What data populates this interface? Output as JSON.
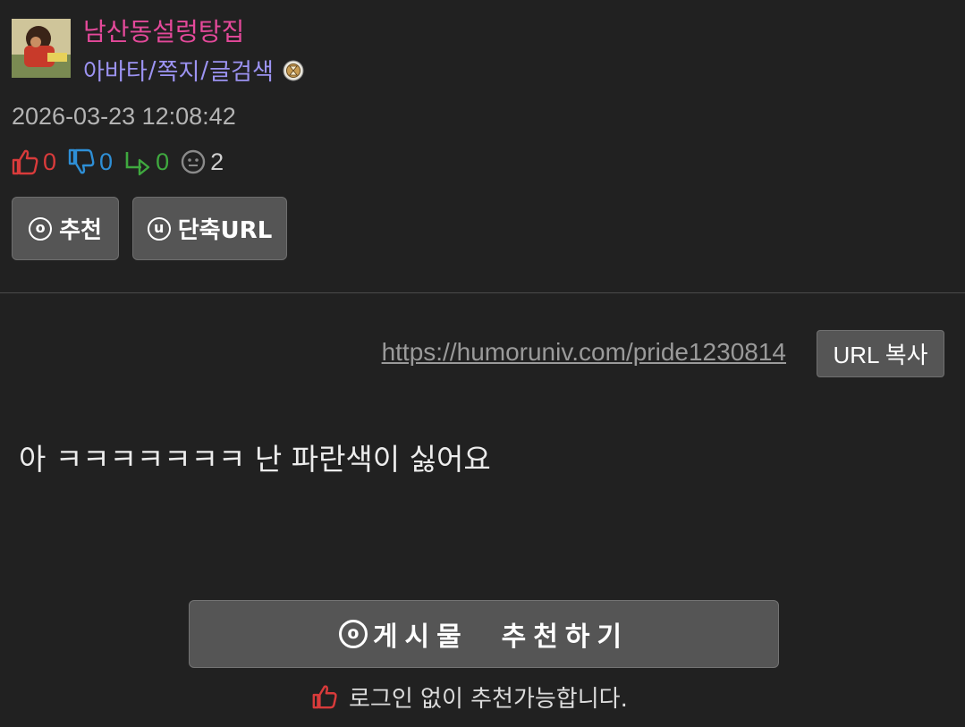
{
  "author": {
    "name": "남산동설렁탕집",
    "links": [
      "아바타",
      "쪽지",
      "글검색"
    ],
    "link_separator": "/",
    "name_color": "#e4499a",
    "link_color": "#9c93f2"
  },
  "post": {
    "date": "2026-03-23 12:08:42",
    "counts": {
      "up": "0",
      "down": "0",
      "share": "0",
      "views": "2"
    },
    "url": "https://humoruniv.com/pride1230814",
    "body": "아 ㅋㅋㅋㅋㅋㅋㅋ 난 파란색이 싫어요"
  },
  "buttons": {
    "recommend_icon_letter": "o",
    "recommend_label": "추천",
    "shorturl_icon_letter": "u",
    "shorturl_label": "단축URL",
    "copy_url_label": "URL 복사",
    "big_recommend_icon_letter": "o",
    "big_recommend_label": "게시물  추천하기"
  },
  "footer": {
    "login_note": "로그인 없이 추천가능합니다."
  },
  "colors": {
    "background": "#212121",
    "button_bg": "#555555",
    "up": "#d93b3b",
    "down": "#2e8fd6",
    "share": "#3fa83f"
  },
  "icons": [
    "avatar-image",
    "level-badge-icon",
    "thumbs-up-icon",
    "thumbs-down-icon",
    "share-arrow-icon",
    "viewer-face-icon"
  ]
}
